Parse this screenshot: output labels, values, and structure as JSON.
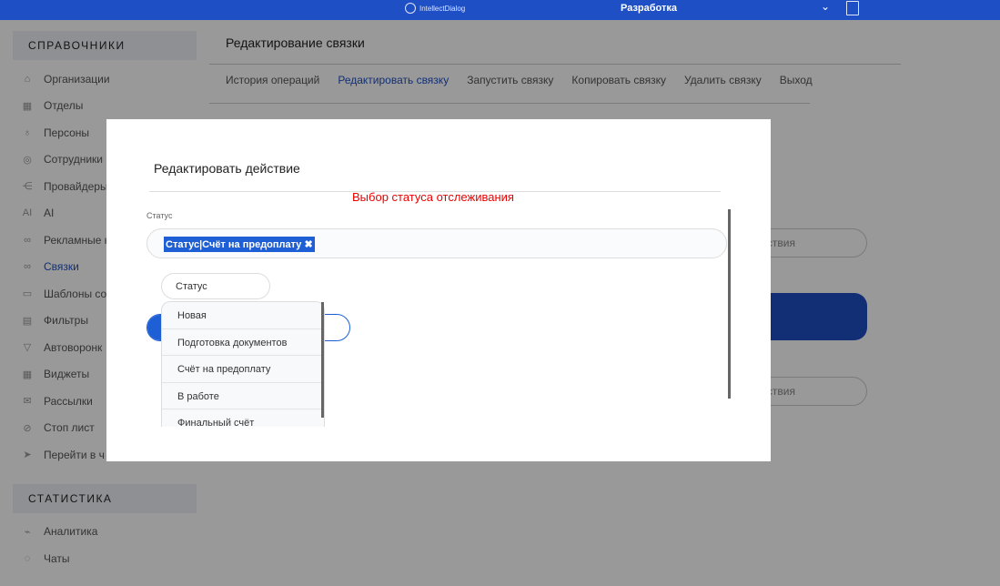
{
  "topbar": {
    "logo": "IntellectDialog",
    "environment": "Разработка"
  },
  "sidebar": {
    "section1": "СПРАВОЧНИКИ",
    "items": [
      {
        "label": "Организации",
        "icon": "home-icon"
      },
      {
        "label": "Отделы",
        "icon": "grid-icon"
      },
      {
        "label": "Персоны",
        "icon": "person-icon"
      },
      {
        "label": "Сотрудники",
        "icon": "employees-icon"
      },
      {
        "label": "Провайдеры",
        "icon": "share-icon"
      },
      {
        "label": "AI",
        "icon": "ai-icon"
      },
      {
        "label": "Рекламные к",
        "icon": "link-icon"
      },
      {
        "label": "Связки",
        "icon": "link-icon",
        "active": true
      },
      {
        "label": "Шаблоны со",
        "icon": "template-icon"
      },
      {
        "label": "Фильтры",
        "icon": "filter-icon"
      },
      {
        "label": "Автоворонк",
        "icon": "funnel-icon"
      },
      {
        "label": "Виджеты",
        "icon": "widget-icon"
      },
      {
        "label": "Рассылки",
        "icon": "mail-icon"
      },
      {
        "label": "Стоп лист",
        "icon": "stop-icon"
      },
      {
        "label": "Перейти в ч",
        "icon": "send-icon"
      }
    ],
    "section2": "СТАТИСТИКА",
    "items2": [
      {
        "label": "Аналитика",
        "icon": "chart-icon"
      },
      {
        "label": "Чаты",
        "icon": "chat-icon"
      }
    ]
  },
  "main": {
    "title": "Редактирование связки",
    "tabs": [
      "История операций",
      "Редактировать связку",
      "Запустить связку",
      "Копировать связку",
      "Удалить связку",
      "Выход"
    ],
    "input1_tail": "ствия",
    "input2_tail": "ствия"
  },
  "modal": {
    "title": "Редактировать действие",
    "hint": "Выбор статуса отслеживания",
    "status_label": "Статус",
    "selected_tag": "Статус|Счёт на предоплату",
    "search_value": "Статус",
    "options": [
      "Новая",
      "Подготовка документов",
      "Счёт на предоплату",
      "В работе",
      "Финальный счёт"
    ]
  }
}
